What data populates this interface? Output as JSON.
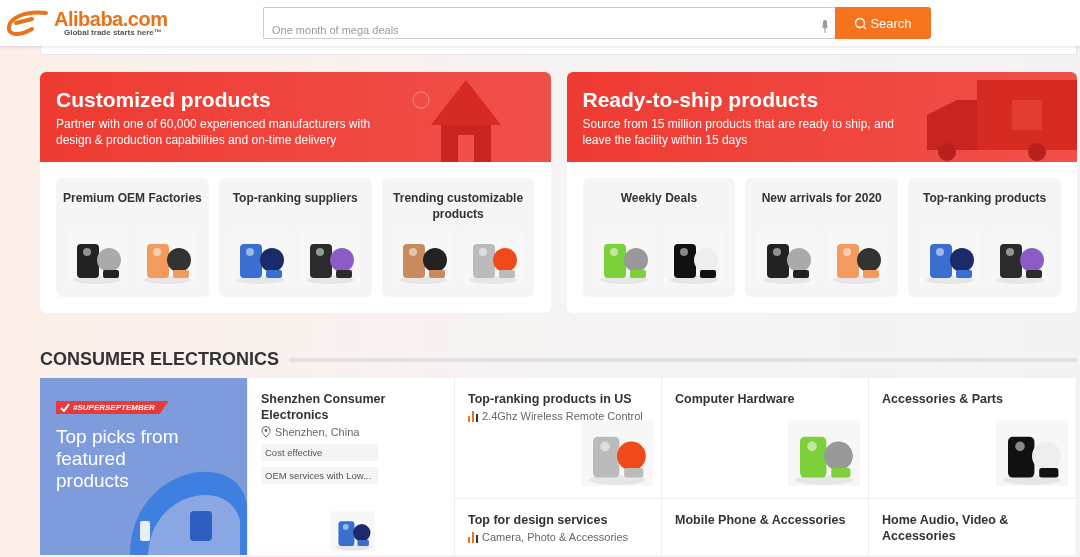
{
  "header": {
    "logo": "Alibaba.com",
    "tagline": "Global trade starts here™",
    "search": {
      "placeholder": "One month of mega deals",
      "button": "Search"
    }
  },
  "promos": [
    {
      "kind": "custom",
      "title": "Customized products",
      "description": "Partner with one of 60,000 experienced manufacturers with design & production capabilities and on-time delivery",
      "tiles": [
        {
          "title": "Premium OEM Factories"
        },
        {
          "title": "Top-ranking suppliers"
        },
        {
          "title": "Trending customizable products"
        }
      ]
    },
    {
      "kind": "ship",
      "title": "Ready-to-ship products",
      "description": "Source from 15 million products that are ready to ship, and leave the facility within 15 days",
      "tiles": [
        {
          "title": "Weekly Deals"
        },
        {
          "title": "New arrivals for 2020"
        },
        {
          "title": "Top-ranking products"
        }
      ]
    }
  ],
  "section": {
    "title": "CONSUMER ELECTRONICS",
    "banner": {
      "tag": "#SUPERSEPTEMBER",
      "headline": "Top picks from featured products"
    },
    "supplier": {
      "title": "Shenzhen Consumer Electronics",
      "location": "Shenzhen, China",
      "tags": [
        "Cost effective",
        "OEM services with Low..."
      ]
    },
    "cells": [
      {
        "title": "Top-ranking products in US",
        "subtitle": "2.4Ghz Wireless Remote Control"
      },
      {
        "title": "Computer Hardware"
      },
      {
        "title": "Accessories & Parts"
      },
      {
        "title": "Top for design services",
        "subtitle": "Camera, Photo & Accessories"
      },
      {
        "title": "Mobile Phone & Accessories"
      },
      {
        "title": "Home Audio, Video & Accessories"
      }
    ]
  }
}
